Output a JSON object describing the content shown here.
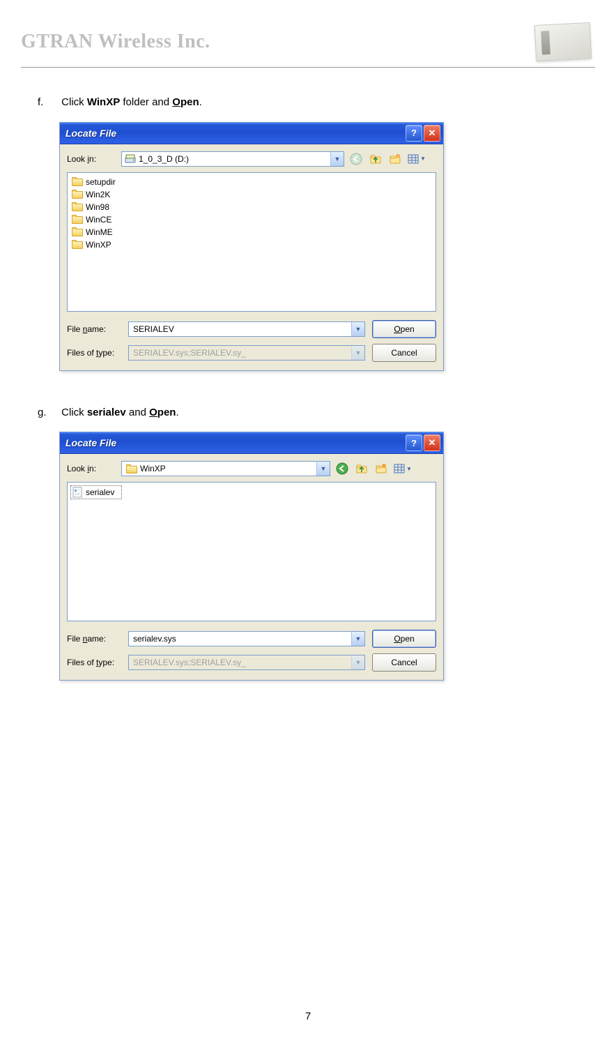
{
  "doc": {
    "company": "GTRAN Wireless Inc.",
    "page_number": "7"
  },
  "steps": {
    "f": {
      "marker": "f.",
      "pre": "Click ",
      "bold1": "WinXP",
      "mid": " folder and ",
      "u_char": "O",
      "bold2_rest": "pen",
      "end": "."
    },
    "g": {
      "marker": "g.",
      "pre": "Click ",
      "bold1": "serialev",
      "mid": " and ",
      "u_char": "O",
      "bold2_rest": "pen",
      "end": "."
    }
  },
  "dialog1": {
    "title": "Locate File",
    "lookin_label": "Look in:",
    "lookin_value": "1_0_3_D (D:)",
    "files": [
      {
        "name": "setupdir",
        "type": "folder"
      },
      {
        "name": "Win2K",
        "type": "folder"
      },
      {
        "name": "Win98",
        "type": "folder"
      },
      {
        "name": "WinCE",
        "type": "folder"
      },
      {
        "name": "WinME",
        "type": "folder"
      },
      {
        "name": "WinXP",
        "type": "folder"
      }
    ],
    "filename_label": "File name:",
    "filename_value": "SERIALEV",
    "filetype_label": "Files of type:",
    "filetype_value": "SERIALEV.sys;SERIALEV.sy_",
    "open_u": "O",
    "open_rest": "pen",
    "cancel": "Cancel"
  },
  "dialog2": {
    "title": "Locate File",
    "lookin_label": "Look in:",
    "lookin_value": "WinXP",
    "files": [
      {
        "name": "serialev",
        "type": "sys",
        "selected": true
      }
    ],
    "filename_label": "File name:",
    "filename_value": "serialev.sys",
    "filetype_label": "Files of type:",
    "filetype_value": "SERIALEV.sys;SERIALEV.sy_",
    "open_u": "O",
    "open_rest": "pen",
    "cancel": "Cancel"
  }
}
